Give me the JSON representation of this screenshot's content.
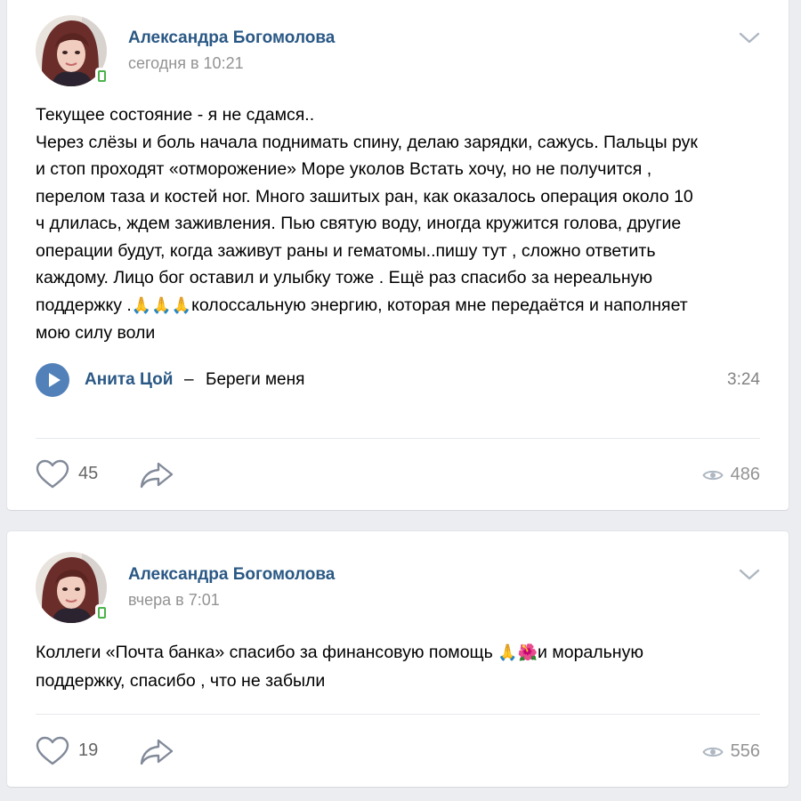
{
  "posts": [
    {
      "author": "Александра Богомолова",
      "date": "сегодня в 10:21",
      "text_lines": [
        "Текущее состояние - я не сдамся..",
        "Через слёзы и боль начала поднимать спину, делаю зарядки, сажусь. Пальцы рук",
        "и стоп проходят «отморожение» Море уколов Встать хочу, но не получится ,",
        "перелом таза и костей ног. Много зашитых ран, как оказалось операция около 10",
        "ч длилась, ждем заживления. Пью святую воду, иногда кружится голова, другие",
        "операции будут, когда заживут раны и гематомы..пишу тут , сложно ответить",
        "каждому. Лицо бог оставил и улыбку тоже . Ещё раз спасибо за нереальную"
      ],
      "text_line8_before": "поддержку .",
      "text_line8_emoji": "🙏🙏🙏",
      "text_line8_after": "колоссальную энергию, которая мне передаётся и наполняет",
      "text_line9": "мою силу воли",
      "audio": {
        "artist": "Анита Цой",
        "dash": "–",
        "title": "Береги меня",
        "duration": "3:24"
      },
      "likes": "45",
      "views": "486"
    },
    {
      "author": "Александра Богомолова",
      "date": "вчера в 7:01",
      "text_line1_before": "Коллеги «Почта банка» спасибо за финансовую помощь ",
      "text_line1_emoji": "🙏🌺",
      "text_line1_after": "и моральную",
      "text_line2": "поддержку, спасибо , что не забыли",
      "likes": "19",
      "views": "556"
    }
  ],
  "icons": {
    "like": "heart-outline-icon",
    "share": "share-arrow-icon",
    "views": "eye-icon",
    "menu": "chevron-down-icon",
    "play": "play-icon",
    "online": "mobile-online-icon"
  },
  "colors": {
    "link": "#2a5885",
    "accent": "#5181b8",
    "muted": "#939393",
    "background": "#ebedf0",
    "online": "#4bb34b"
  }
}
